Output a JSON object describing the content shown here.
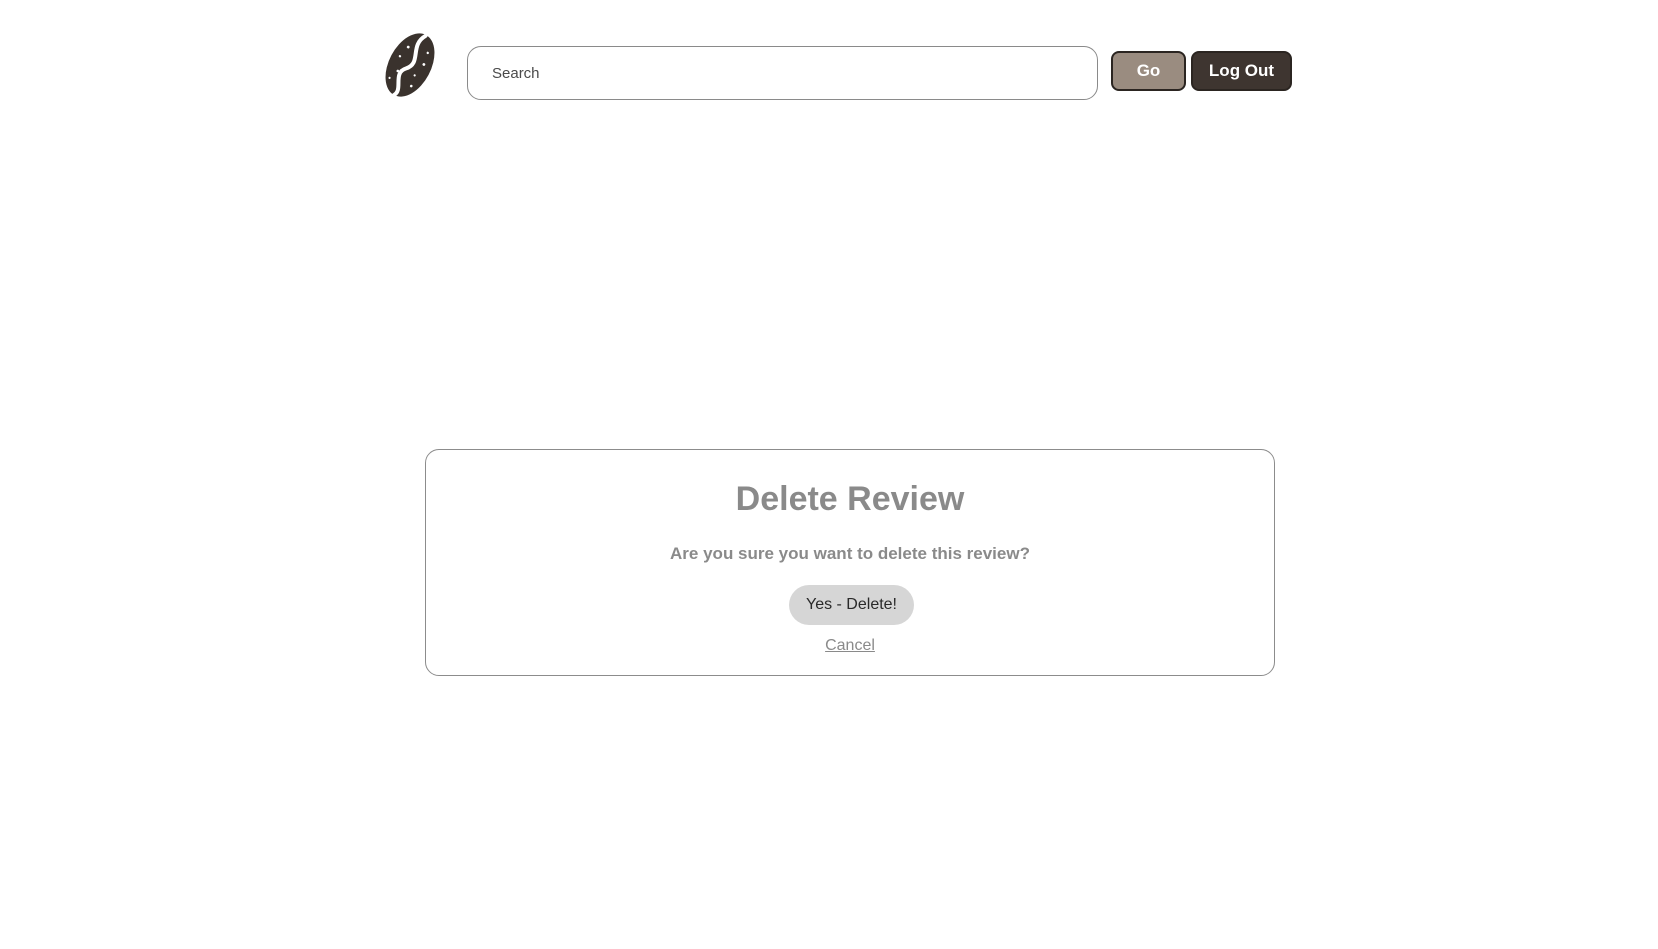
{
  "header": {
    "logo_icon": "coffee-bean-icon",
    "search": {
      "placeholder": "Search",
      "value": ""
    },
    "go_label": "Go",
    "logout_label": "Log Out"
  },
  "modal": {
    "title": "Delete Review",
    "message": "Are you sure you want to delete this review?",
    "confirm_label": "Yes - Delete!",
    "cancel_label": "Cancel"
  },
  "colors": {
    "brand_dark": "#3e3530",
    "brand_light": "#9a8c80",
    "muted_text": "#8a8a8a",
    "confirm_bg": "#d6d6d6"
  }
}
